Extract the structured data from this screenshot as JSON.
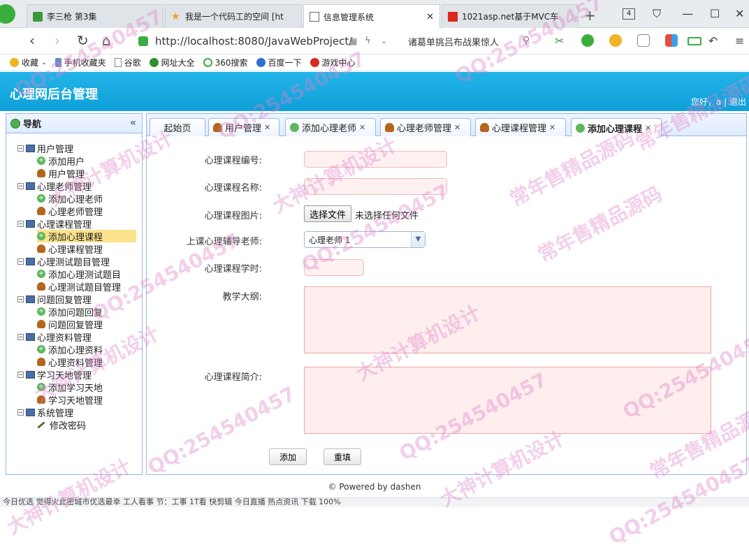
{
  "browser": {
    "tabs": [
      {
        "label": "李三枪 第3集",
        "icon": "video-icon",
        "active": false
      },
      {
        "label": "我是一个代码工的空间 [ht",
        "icon": "star-icon",
        "active": false
      },
      {
        "label": "信息管理系统",
        "icon": "page-icon",
        "active": true
      },
      {
        "label": "1021asp.net基于MVC车",
        "icon": "red-square-icon",
        "active": false
      }
    ],
    "tab_count": "4",
    "url": "http://localhost:8080/JavaWebProject/",
    "news_text": "诸葛单挑吕布战果惊人"
  },
  "bookmarks": [
    {
      "label": "收藏",
      "icon": "star-icon"
    },
    {
      "label": "手机收藏夹",
      "icon": "phone-icon"
    },
    {
      "label": "谷歌",
      "icon": "page-icon"
    },
    {
      "label": "网址大全",
      "icon": "globe-icon"
    },
    {
      "label": "360搜索",
      "icon": "search-icon"
    },
    {
      "label": "百度一下",
      "icon": "paw-icon"
    },
    {
      "label": "游戏中心",
      "icon": "game-icon"
    }
  ],
  "header": {
    "title": "心理网后台管理",
    "greeting": "您好，a",
    "separator": "|",
    "logout": "退出"
  },
  "sidebar": {
    "title": "导航",
    "collapse_glyph": "«",
    "groups": [
      {
        "label": "用户管理",
        "items": [
          "添加用户",
          "用户管理"
        ]
      },
      {
        "label": "心理老师管理",
        "items": [
          "添加心理老师",
          "心理老师管理"
        ]
      },
      {
        "label": "心理课程管理",
        "items": [
          "添加心理课程",
          "心理课程管理"
        ]
      },
      {
        "label": "心理测试题目管理",
        "items": [
          "添加心理测试题目",
          "心理测试题目管理"
        ]
      },
      {
        "label": "问题回复管理",
        "items": [
          "添加问题回复",
          "问题回复管理"
        ]
      },
      {
        "label": "心理资料管理",
        "items": [
          "添加心理资料",
          "心理资料管理"
        ]
      },
      {
        "label": "学习天地管理",
        "items": [
          "添加学习天地",
          "学习天地管理"
        ]
      },
      {
        "label": "系统管理",
        "items": [
          "修改密码"
        ]
      }
    ],
    "selected": "添加心理课程"
  },
  "content_tabs": [
    {
      "label": "起始页",
      "icon": "",
      "closable": false
    },
    {
      "label": "用户管理",
      "icon": "person-icon",
      "closable": true
    },
    {
      "label": "添加心理老师",
      "icon": "add-icon",
      "closable": true
    },
    {
      "label": "心理老师管理",
      "icon": "person-icon",
      "closable": true
    },
    {
      "label": "心理课程管理",
      "icon": "person-icon",
      "closable": true
    },
    {
      "label": "添加心理课程",
      "icon": "add-icon",
      "closable": true,
      "active": true
    }
  ],
  "form": {
    "course_no_label": "心理课程编号:",
    "course_name_label": "心理课程名称:",
    "course_image_label": "心理课程图片:",
    "file_button": "选择文件",
    "file_status": "未选择任何文件",
    "teacher_label": "上课心理辅导老师:",
    "teacher_value": "心理老师 1",
    "hours_label": "心理课程学时:",
    "syllabus_label": "教学大纲:",
    "intro_label": "心理课程简介:",
    "submit": "添加",
    "reset": "重填"
  },
  "footer": "© Powered by dashen",
  "status_bar": "今日优选   觉得火此密城市优选最幸   工人看事   节：工事   1T看   快剪辑   今日直播   热点资讯   下载   100%",
  "watermark": {
    "texts": [
      "QQ:254540457",
      "大神计算机设计",
      "常年售精品源码"
    ]
  },
  "colors": {
    "header_bg": "#0e9fd8",
    "panel_border": "#95b8e7",
    "selected_node": "#fbe28b",
    "invalid_field_bg": "#fff1f1"
  }
}
